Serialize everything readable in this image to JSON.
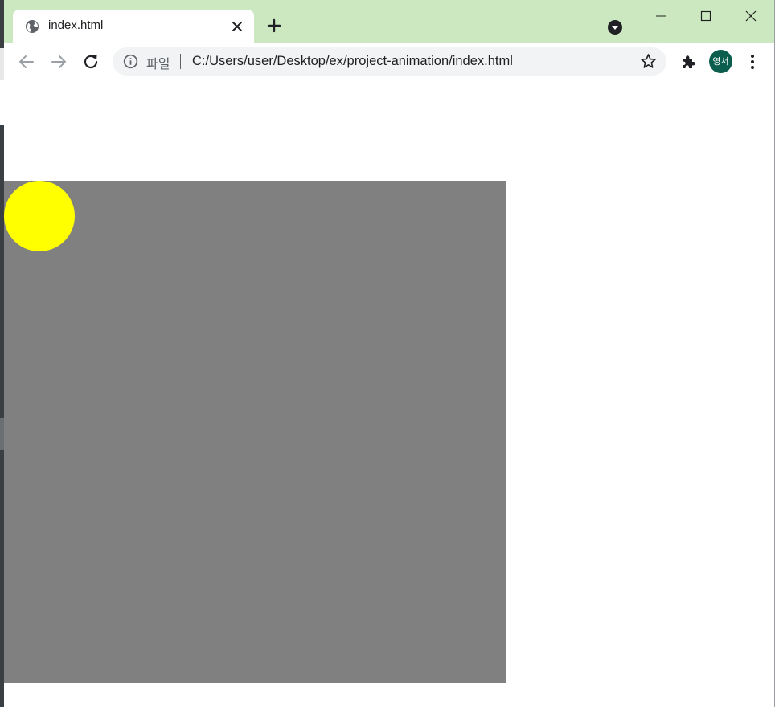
{
  "tab": {
    "title": "index.html",
    "favicon": "globe-icon"
  },
  "toolbar": {
    "scheme_label": "파일",
    "url": "C:/Users/user/Desktop/ex/project-animation/index.html"
  },
  "profile": {
    "initials": "영서",
    "color": "#0b5d4e"
  },
  "page": {
    "stage_color": "#808080",
    "ball_color": "#ffff00"
  },
  "theme": {
    "frame_color": "#cbe8c1"
  }
}
